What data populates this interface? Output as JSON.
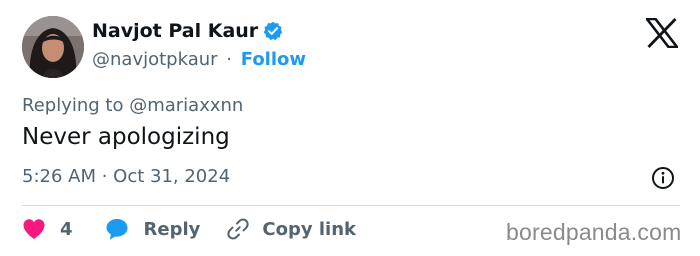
{
  "author": {
    "name": "Navjot Pal Kaur",
    "handle": "@navjotpkaur",
    "separator": "·",
    "follow_label": "Follow"
  },
  "tweet": {
    "replying_prefix": "Replying to",
    "replying_to": "@mariaxxnn",
    "text": "Never apologizing",
    "timestamp": "5:26 AM · Oct 31, 2024"
  },
  "actions": {
    "like_count": "4",
    "reply_label": "Reply",
    "copy_label": "Copy link"
  },
  "watermark": "boredpanda.com",
  "icons": {
    "verified": "verified-badge-icon",
    "x_logo": "x-logo-icon",
    "info": "info-icon",
    "heart": "heart-icon",
    "reply": "reply-bubble-icon",
    "link": "link-icon"
  },
  "colors": {
    "accent": "#1d9bf0",
    "like": "#f91880",
    "text": "#0f1419",
    "secondary": "#536471"
  }
}
